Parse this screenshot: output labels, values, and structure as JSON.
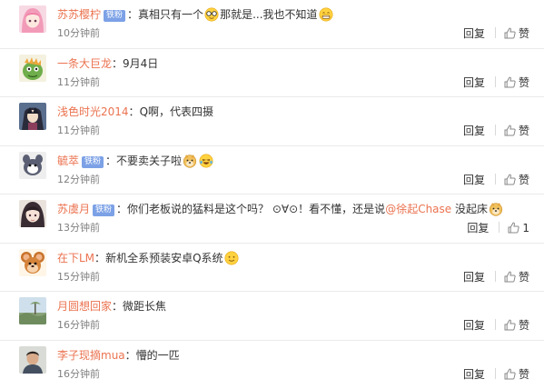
{
  "reply_label": "回复",
  "like_icon": "thumbs-up-icon",
  "colors": {
    "username": "#eb7350",
    "badge": "#7ca1e6",
    "timestamp": "#808080",
    "text": "#333333"
  },
  "comments": [
    {
      "username": "苏苏樱柠",
      "badge": "铁粉",
      "text": "真相只有一个",
      "emoji1": "detective-glasses-emoji",
      "tail": "那就是...我也不知道",
      "emoji2": "grinning-teeth-emoji",
      "time": "10分钟前",
      "likes": "赞",
      "avatar": "anime-girl-pink-hair-avatar"
    },
    {
      "username": "一条大巨龙",
      "badge": "",
      "text": "9月4日",
      "time": "11分钟前",
      "likes": "赞",
      "avatar": "green-dinosaur-avatar"
    },
    {
      "username": "浅色时光2014",
      "badge": "",
      "text": "Q啊，代表四摄",
      "time": "11分钟前",
      "likes": "赞",
      "avatar": "dark-anime-character-avatar"
    },
    {
      "username": "毓萃",
      "badge": "铁粉",
      "text": "不要卖关子啦",
      "emoji1": "doge-emoji",
      "emoji2": "laughing-tears-emoji",
      "time": "12分钟前",
      "likes": "赞",
      "avatar": "cartoon-creature-avatar"
    },
    {
      "username": "苏虞月",
      "badge": "铁粉",
      "text": "你们老板说的猛料是这个吗？ ⊙∀⊙！看不懂，还是说",
      "mention": "@徐起Chase",
      "tail": " 没起床",
      "emoji2": "doge-emoji",
      "time": "13分钟前",
      "likes": "1",
      "avatar": "anime-girl-dark-hair-avatar"
    },
    {
      "username": "在下LM",
      "badge": "",
      "text": "新机全系预装安卓Q系统",
      "emoji1": "smiling-face-emoji",
      "time": "15分钟前",
      "likes": "赞",
      "avatar": "cartoon-mouse-avatar"
    },
    {
      "username": "月圆想回家",
      "badge": "",
      "text": "微距长焦",
      "time": "16分钟前",
      "likes": "赞",
      "avatar": "landscape-photo-avatar"
    },
    {
      "username": "李子现摘mua",
      "badge": "",
      "text": "懵的一匹",
      "time": "16分钟前",
      "likes": "赞",
      "avatar": "portrait-photo-avatar"
    }
  ]
}
